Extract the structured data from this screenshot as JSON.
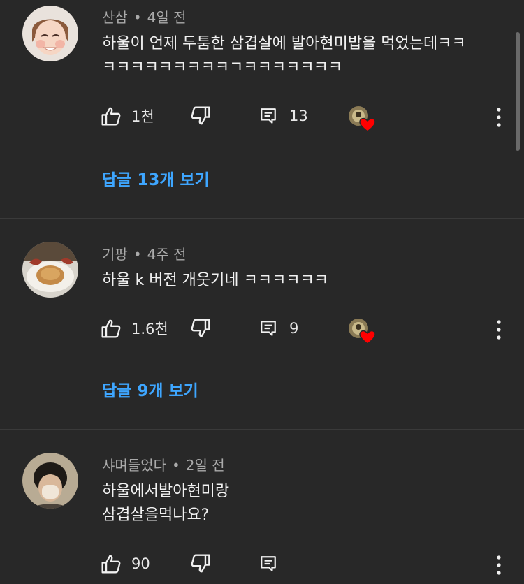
{
  "comments": [
    {
      "author": "산삼",
      "time": "4일 전",
      "text": "하울이 언제 두툼한 삼겹살에 발아현미밥을 먹었는데ㅋㅋ\nㅋㅋㅋㅋㅋㅋㅋㅋㅋㄱㅋㅋㅋㅋㅋㅋㅋ",
      "likes": "1천",
      "reply_count": "13",
      "view_replies": "답글 13개 보기"
    },
    {
      "author": "기팡",
      "time": "4주 전",
      "text": "하울 k 버전 개웃기네 ㅋㅋㅋㅋㅋㅋ",
      "likes": "1.6천",
      "reply_count": "9",
      "view_replies": "답글 9개 보기"
    },
    {
      "author": "샤며들었다",
      "time": "2일 전",
      "text": "하울에서발아현미랑\n삼겹살을먹나요?",
      "likes": "90",
      "reply_count": ""
    }
  ],
  "separator": "•",
  "icons": {
    "like": "thumbs-up-icon",
    "dislike": "thumbs-down-icon",
    "reply": "comment-icon",
    "creator_heart": "creator-heart-icon",
    "more": "kebab-menu-icon"
  },
  "colors": {
    "background": "#282828",
    "link": "#3ea6ff",
    "heart": "#ff0000",
    "meta_text": "#aaaaaa"
  }
}
